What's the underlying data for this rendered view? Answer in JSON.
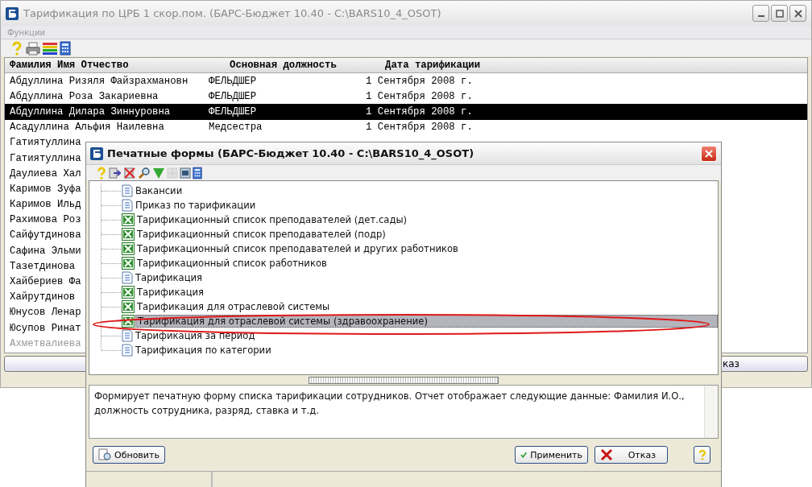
{
  "main_window": {
    "title": "Тарификация по ЦРБ 1 скор.пом. (БАРС-Бюджет 10.40 - C:\\BARS10_4_OSOT)",
    "menu": [
      "Функции"
    ],
    "table": {
      "columns": [
        "Фамилия Имя Отчество",
        "Основная должность",
        "Дата тарификации"
      ],
      "rows": [
        {
          "name": "Абдуллина Ризяля Файзрахмановн",
          "position": "ФЕЛЬДШЕР",
          "date": "1 Сентября 2008 г.",
          "selected": false,
          "disabled": false
        },
        {
          "name": "Абдуллина Роза Закариевна",
          "position": "ФЕЛЬДШЕР",
          "date": "1 Сентября 2008 г.",
          "selected": false,
          "disabled": false
        },
        {
          "name": "Абдуллина Дилара Зиннуровна",
          "position": "ФЕЛЬДШЕР",
          "date": "1 Сентября 2008 г.",
          "selected": true,
          "disabled": false
        },
        {
          "name": "Асадуллина Альфия Наилевна",
          "position": "Медсестра",
          "date": "1 Сентября 2008 г.",
          "selected": false,
          "disabled": false
        },
        {
          "name": "Гатиятуллина",
          "selected": false,
          "disabled": false
        },
        {
          "name": "Гатиятуллина",
          "selected": false,
          "disabled": false
        },
        {
          "name": "Даулиева Хал",
          "selected": false,
          "disabled": false
        },
        {
          "name": "Каримов Зуфа",
          "selected": false,
          "disabled": false
        },
        {
          "name": "Каримов Ильд",
          "selected": false,
          "disabled": false
        },
        {
          "name": "Рахимова Роз",
          "selected": false,
          "disabled": false
        },
        {
          "name": "Сайфутдинова",
          "selected": false,
          "disabled": false
        },
        {
          "name": "Сафина Эльми",
          "selected": false,
          "disabled": false
        },
        {
          "name": "Тазетдинова",
          "selected": false,
          "disabled": false
        },
        {
          "name": "Хайбериев Фа",
          "selected": false,
          "disabled": false
        },
        {
          "name": "Хайрутдинов",
          "selected": false,
          "disabled": false
        },
        {
          "name": "Юнусов Ленар",
          "selected": false,
          "disabled": false
        },
        {
          "name": "Юсупов Ринат",
          "selected": false,
          "disabled": false
        },
        {
          "name": "Ахметвалиева",
          "selected": false,
          "disabled": true
        }
      ]
    },
    "bottom_button": "каз"
  },
  "dialog": {
    "title": "Печатные формы (БАРС-Бюджет 10.40 - C:\\BARS10_4_OSOT)",
    "tree": [
      {
        "label": "Вакансии",
        "kind": "document",
        "selected": false
      },
      {
        "label": "Приказ по тарификации",
        "kind": "document",
        "selected": false
      },
      {
        "label": "Тарификационный список преподавателей (дет.сады)",
        "kind": "excel",
        "selected": false
      },
      {
        "label": "Тарификационный список преподавателей (подр)",
        "kind": "excel",
        "selected": false
      },
      {
        "label": "Тарификационный список преподавателей и других работников",
        "kind": "excel",
        "selected": false
      },
      {
        "label": "Тарификационный список работников",
        "kind": "excel",
        "selected": false
      },
      {
        "label": "Тарификация",
        "kind": "document",
        "selected": false
      },
      {
        "label": "Тарификация",
        "kind": "excel",
        "selected": false
      },
      {
        "label": "Тарификация для отраслевой системы",
        "kind": "excel",
        "selected": false
      },
      {
        "label": "Тарификация для отраслевой системы (здравоохранение)",
        "kind": "excel",
        "selected": true
      },
      {
        "label": "Тарификация за период",
        "kind": "document",
        "selected": false
      },
      {
        "label": "Тарификация по категории",
        "kind": "document",
        "selected": false
      }
    ],
    "description": "Формирует печатную форму списка тарификации сотрудников. Отчет отображает следующие данные: Фамилия И.О., должность сотрудника, разряд, ставка и т.д.",
    "buttons": [
      {
        "kind": "refresh",
        "label": "Обновить"
      },
      {
        "kind": "apply",
        "label": "Применить"
      },
      {
        "kind": "cancel",
        "label": "Отказ"
      },
      {
        "kind": "help"
      }
    ]
  }
}
